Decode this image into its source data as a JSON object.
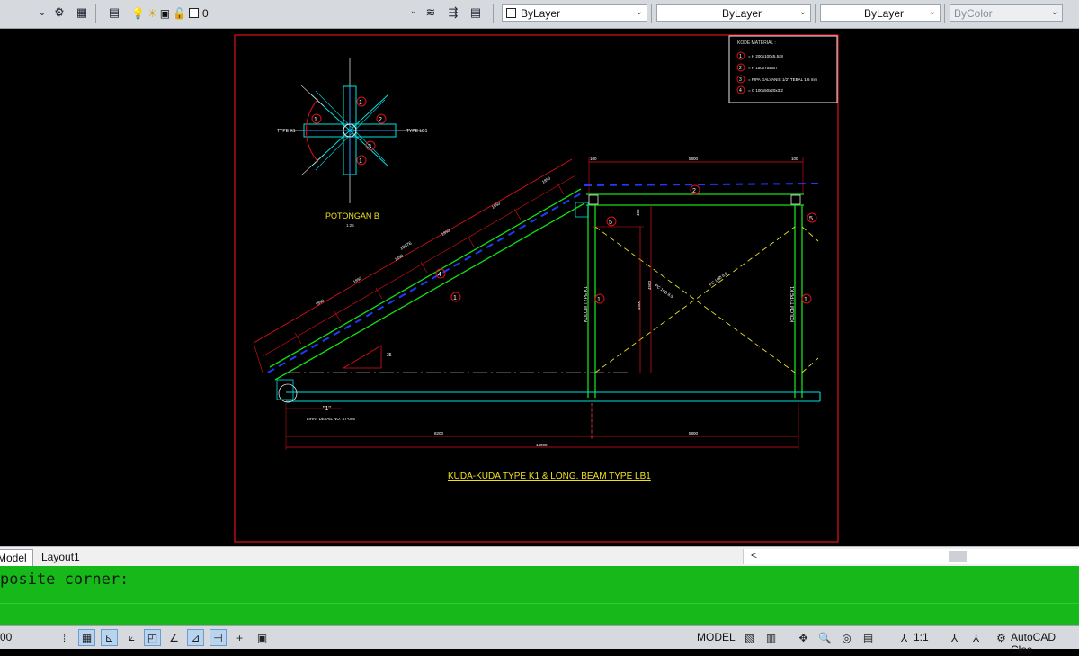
{
  "toolbar": {
    "layer_name": "0",
    "color_combo": "ByLayer",
    "linetype_combo": "ByLayer",
    "lineweight_combo": "ByLayer",
    "plotstyle_combo": "ByColor"
  },
  "drawing": {
    "main_title": "KUDA-KUDA TYPE K1  & LONG. BEAM TYPE LB1",
    "section_title": "POTONGAN B",
    "section_scale": "1:25",
    "material_heading": "KODE MATERIAL :",
    "materials": [
      {
        "num": "1",
        "text": "= H 200x100x5.5x8"
      },
      {
        "num": "2",
        "text": "= H 150x75x5x7"
      },
      {
        "num": "3",
        "text": "= PIPA GALVANIS 1/2\" TEBAL 1.6 mm"
      },
      {
        "num": "4",
        "text": "= C 100x50x20x3.2"
      }
    ],
    "detail_label": "\"1\"",
    "anchor_note": "LIHAT DETAIL NO. ST-005",
    "type_k1": "TYPE K1",
    "type_lb1": "TYPE LB1",
    "column_label": "KOLOM TYPE K1",
    "dims": {
      "total_span": "14000",
      "left_span": "8200",
      "right_span": "5800",
      "top_mid": "5800",
      "top_left": "100",
      "top_right": "100",
      "rafter_total": "10076",
      "seg_a": "1850",
      "seg_b": "1850",
      "seg_c": "1850",
      "seg_d": "1850",
      "seg_e": "1850",
      "seg_f": "1850",
      "col_height": "4500",
      "small_h": "400",
      "angle": "35",
      "brace_a": "PC 16Ø 8.5",
      "brace_b": "PC 16Ø 8.5"
    }
  },
  "tabs": {
    "model": "Model",
    "layout1": "Layout1"
  },
  "command": {
    "history": "posite corner:"
  },
  "status": {
    "coords": "00",
    "model": "MODEL",
    "scale": "1:1",
    "workspace": "AutoCAD Clas"
  }
}
